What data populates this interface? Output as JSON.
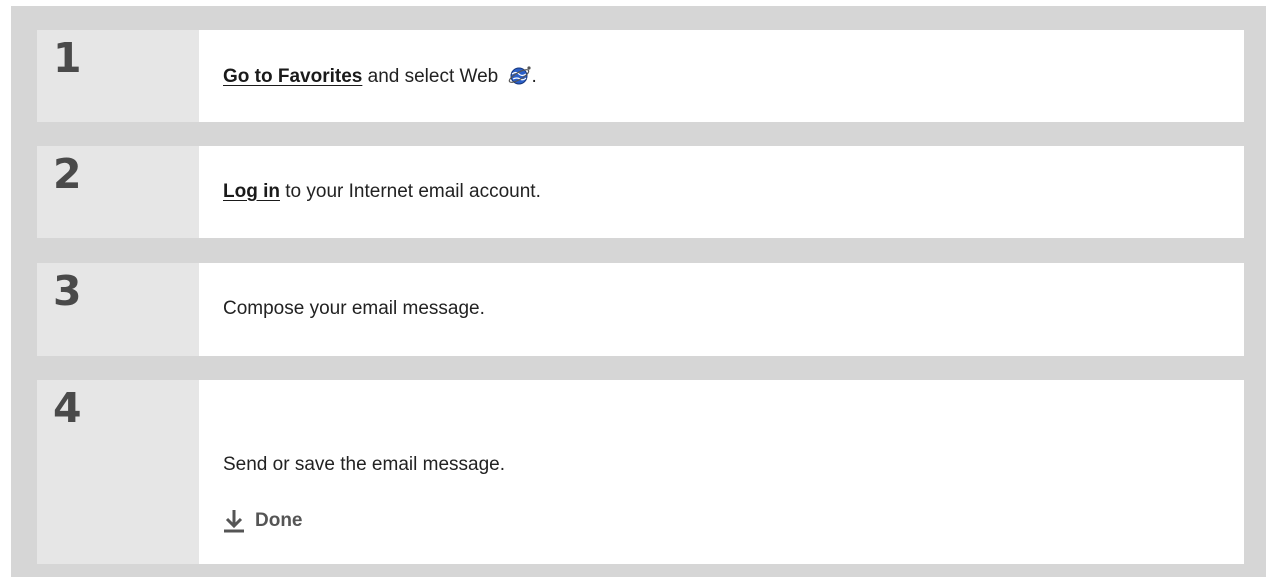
{
  "steps": [
    {
      "number": "1",
      "link": "Go to Favorites",
      "text": " and select Web ",
      "after_icon": ".",
      "icon": "web-globe-icon"
    },
    {
      "number": "2",
      "link": "Log in",
      "text": " to your Internet email account."
    },
    {
      "number": "3",
      "text": "Compose your email message."
    },
    {
      "number": "4",
      "text": "Send or save the email message.",
      "done_label": "Done",
      "done_icon": "down-arrow-icon"
    }
  ],
  "colors": {
    "frame_bg": "#d6d6d6",
    "number_cell_bg": "#e6e6e6",
    "text_cell_bg": "#ffffff",
    "number_color": "#4a4a4a",
    "done_color": "#555555",
    "globe_blue": "#2a5fc8"
  }
}
